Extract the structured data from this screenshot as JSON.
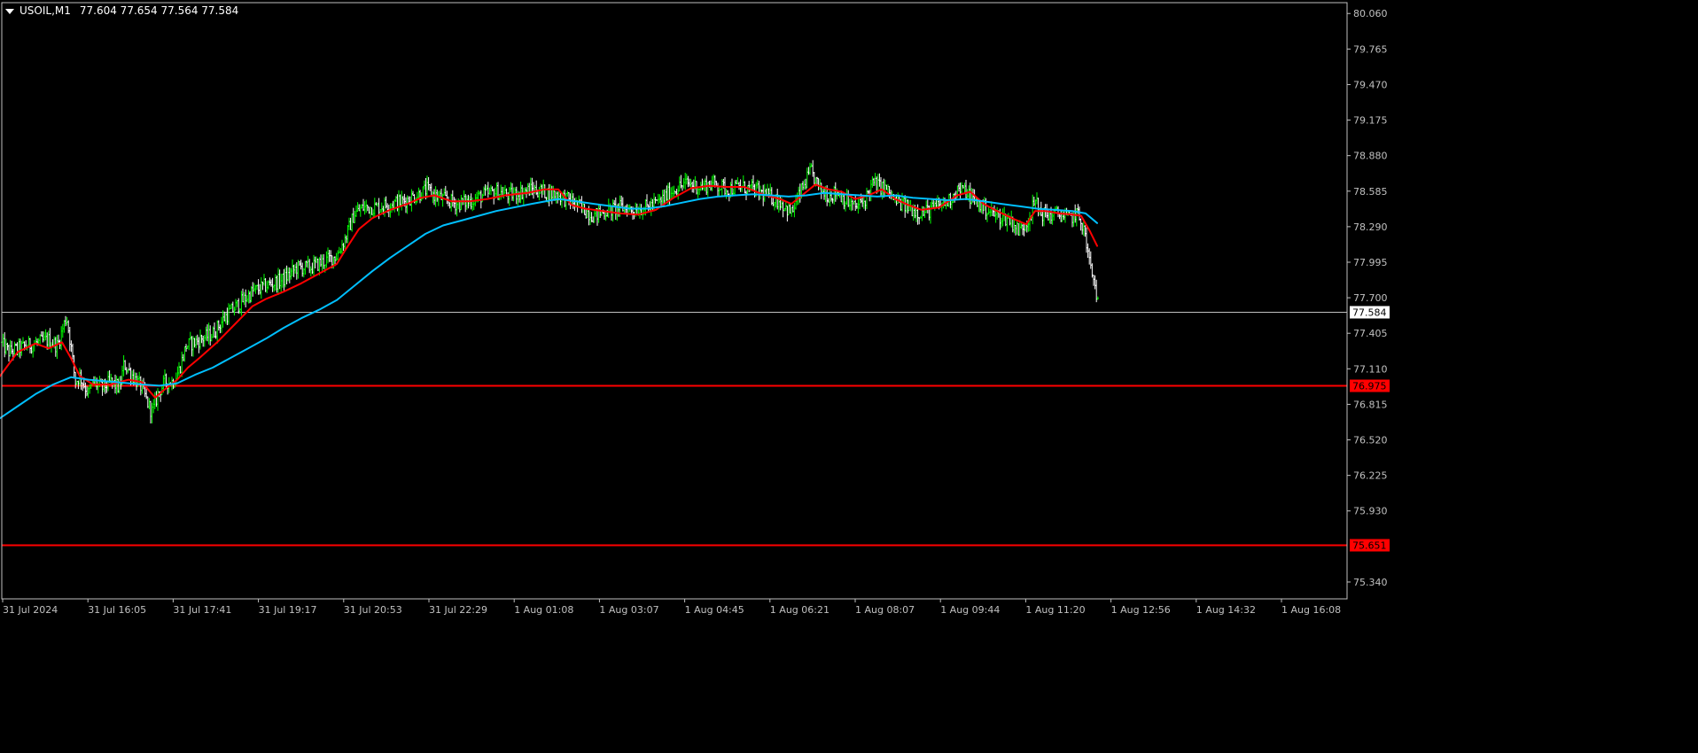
{
  "header": {
    "symbol": "USOIL,M1",
    "ohlc": "77.604 77.654 77.564 77.584",
    "menu_icon": "triangle-down-icon"
  },
  "colors": {
    "background": "#000000",
    "bull_bar": "#00ff00",
    "bear_bar": "#ffffff",
    "ma_fast": "#ff0000",
    "ma_slow": "#00bfff",
    "level_line": "#ff0000",
    "axis": "#c0c0c0",
    "bid_label_bg": "#ffffff",
    "bid_label_text": "#000000",
    "level_label_bg": "#ff0000",
    "level_label_text": "#000000"
  },
  "chart_data": {
    "type": "candlestick",
    "symbol": "USOIL",
    "timeframe": "M1",
    "ylim": [
      75.2,
      80.15
    ],
    "y_ticks": [
      "80.060",
      "79.765",
      "79.470",
      "79.175",
      "78.880",
      "78.585",
      "78.290",
      "77.995",
      "77.700",
      "77.405",
      "77.110",
      "76.815",
      "76.520",
      "76.225",
      "75.930",
      "75.340"
    ],
    "x_ticks": [
      "31 Jul 2024",
      "31 Jul 16:05",
      "31 Jul 17:41",
      "31 Jul 19:17",
      "31 Jul 20:53",
      "31 Jul 22:29",
      "1 Aug 01:08",
      "1 Aug 03:07",
      "1 Aug 04:45",
      "1 Aug 06:21",
      "1 Aug 08:07",
      "1 Aug 09:44",
      "1 Aug 11:20",
      "1 Aug 12:56",
      "1 Aug 14:32",
      "1 Aug 16:08"
    ],
    "price_path": [
      [
        0,
        77.33
      ],
      [
        10,
        77.25
      ],
      [
        30,
        77.3
      ],
      [
        55,
        77.35
      ],
      [
        65,
        77.3
      ],
      [
        75,
        77.55
      ],
      [
        80,
        77.3
      ],
      [
        85,
        77.0
      ],
      [
        90,
        77.05
      ],
      [
        100,
        76.9
      ],
      [
        105,
        77.0
      ],
      [
        115,
        76.95
      ],
      [
        125,
        77.0
      ],
      [
        135,
        76.95
      ],
      [
        140,
        77.15
      ],
      [
        150,
        77.05
      ],
      [
        160,
        76.95
      ],
      [
        168,
        76.8
      ],
      [
        172,
        76.75
      ],
      [
        178,
        76.9
      ],
      [
        186,
        77.0
      ],
      [
        195,
        77.0
      ],
      [
        202,
        77.1
      ],
      [
        210,
        77.3
      ],
      [
        225,
        77.35
      ],
      [
        240,
        77.4
      ],
      [
        255,
        77.55
      ],
      [
        270,
        77.65
      ],
      [
        285,
        77.75
      ],
      [
        300,
        77.8
      ],
      [
        320,
        77.85
      ],
      [
        335,
        77.95
      ],
      [
        350,
        77.95
      ],
      [
        365,
        78.0
      ],
      [
        380,
        78.05
      ],
      [
        390,
        78.2
      ],
      [
        400,
        78.4
      ],
      [
        410,
        78.45
      ],
      [
        425,
        78.45
      ],
      [
        440,
        78.48
      ],
      [
        455,
        78.5
      ],
      [
        470,
        78.55
      ],
      [
        482,
        78.6
      ],
      [
        490,
        78.55
      ],
      [
        500,
        78.52
      ],
      [
        515,
        78.48
      ],
      [
        530,
        78.5
      ],
      [
        545,
        78.55
      ],
      [
        560,
        78.58
      ],
      [
        575,
        78.55
      ],
      [
        590,
        78.58
      ],
      [
        600,
        78.6
      ],
      [
        615,
        78.58
      ],
      [
        630,
        78.55
      ],
      [
        645,
        78.5
      ],
      [
        655,
        78.45
      ],
      [
        670,
        78.38
      ],
      [
        685,
        78.42
      ],
      [
        700,
        78.45
      ],
      [
        715,
        78.43
      ],
      [
        730,
        78.45
      ],
      [
        745,
        78.5
      ],
      [
        760,
        78.6
      ],
      [
        775,
        78.65
      ],
      [
        790,
        78.62
      ],
      [
        805,
        78.65
      ],
      [
        820,
        78.6
      ],
      [
        835,
        78.62
      ],
      [
        850,
        78.6
      ],
      [
        865,
        78.55
      ],
      [
        880,
        78.5
      ],
      [
        893,
        78.4
      ],
      [
        905,
        78.6
      ],
      [
        915,
        78.75
      ],
      [
        925,
        78.6
      ],
      [
        935,
        78.55
      ],
      [
        945,
        78.58
      ],
      [
        955,
        78.5
      ],
      [
        965,
        78.45
      ],
      [
        975,
        78.5
      ],
      [
        985,
        78.65
      ],
      [
        1000,
        78.6
      ],
      [
        1010,
        78.5
      ],
      [
        1025,
        78.45
      ],
      [
        1040,
        78.4
      ],
      [
        1055,
        78.45
      ],
      [
        1070,
        78.5
      ],
      [
        1080,
        78.6
      ],
      [
        1090,
        78.58
      ],
      [
        1100,
        78.5
      ],
      [
        1110,
        78.45
      ],
      [
        1125,
        78.38
      ],
      [
        1140,
        78.35
      ],
      [
        1150,
        78.25
      ],
      [
        1160,
        78.35
      ],
      [
        1168,
        78.5
      ],
      [
        1175,
        78.4
      ],
      [
        1185,
        78.38
      ],
      [
        1195,
        78.4
      ],
      [
        1205,
        78.35
      ],
      [
        1215,
        78.4
      ],
      [
        1222,
        78.3
      ],
      [
        1228,
        78.05
      ],
      [
        1232,
        77.9
      ],
      [
        1237,
        77.75
      ],
      [
        1240,
        77.6
      ]
    ],
    "series": [
      {
        "name": "",
        "color": "#ff0000",
        "points": [
          [
            0,
            77.05
          ],
          [
            20,
            77.25
          ],
          [
            40,
            77.32
          ],
          [
            55,
            77.28
          ],
          [
            70,
            77.33
          ],
          [
            80,
            77.2
          ],
          [
            90,
            77.05
          ],
          [
            105,
            76.98
          ],
          [
            125,
            76.98
          ],
          [
            145,
            77.02
          ],
          [
            160,
            77.0
          ],
          [
            175,
            76.87
          ],
          [
            186,
            76.94
          ],
          [
            200,
            77.02
          ],
          [
            212,
            77.12
          ],
          [
            225,
            77.2
          ],
          [
            245,
            77.33
          ],
          [
            265,
            77.48
          ],
          [
            285,
            77.63
          ],
          [
            300,
            77.69
          ],
          [
            320,
            77.75
          ],
          [
            340,
            77.82
          ],
          [
            360,
            77.9
          ],
          [
            380,
            77.98
          ],
          [
            390,
            78.1
          ],
          [
            405,
            78.27
          ],
          [
            420,
            78.36
          ],
          [
            440,
            78.43
          ],
          [
            460,
            78.48
          ],
          [
            475,
            78.53
          ],
          [
            490,
            78.55
          ],
          [
            510,
            78.5
          ],
          [
            530,
            78.5
          ],
          [
            550,
            78.52
          ],
          [
            570,
            78.55
          ],
          [
            595,
            78.57
          ],
          [
            615,
            78.6
          ],
          [
            630,
            78.6
          ],
          [
            645,
            78.47
          ],
          [
            660,
            78.44
          ],
          [
            680,
            78.42
          ],
          [
            700,
            78.4
          ],
          [
            720,
            78.39
          ],
          [
            740,
            78.43
          ],
          [
            760,
            78.53
          ],
          [
            780,
            78.61
          ],
          [
            800,
            78.63
          ],
          [
            820,
            78.62
          ],
          [
            840,
            78.62
          ],
          [
            860,
            78.56
          ],
          [
            880,
            78.52
          ],
          [
            893,
            78.48
          ],
          [
            905,
            78.55
          ],
          [
            920,
            78.64
          ],
          [
            935,
            78.6
          ],
          [
            950,
            78.58
          ],
          [
            965,
            78.52
          ],
          [
            980,
            78.55
          ],
          [
            995,
            78.6
          ],
          [
            1010,
            78.52
          ],
          [
            1025,
            78.47
          ],
          [
            1040,
            78.43
          ],
          [
            1060,
            78.45
          ],
          [
            1080,
            78.55
          ],
          [
            1095,
            78.58
          ],
          [
            1110,
            78.48
          ],
          [
            1125,
            78.42
          ],
          [
            1145,
            78.35
          ],
          [
            1158,
            78.31
          ],
          [
            1168,
            78.42
          ],
          [
            1180,
            78.42
          ],
          [
            1195,
            78.4
          ],
          [
            1210,
            78.39
          ],
          [
            1220,
            78.38
          ],
          [
            1230,
            78.25
          ],
          [
            1238,
            78.13
          ]
        ]
      },
      {
        "name": "",
        "color": "#00bfff",
        "points": [
          [
            0,
            76.7
          ],
          [
            20,
            76.8
          ],
          [
            40,
            76.9
          ],
          [
            60,
            76.98
          ],
          [
            80,
            77.04
          ],
          [
            100,
            77.02
          ],
          [
            130,
            77.0
          ],
          [
            160,
            76.98
          ],
          [
            180,
            76.97
          ],
          [
            200,
            76.99
          ],
          [
            220,
            77.06
          ],
          [
            240,
            77.12
          ],
          [
            260,
            77.2
          ],
          [
            280,
            77.28
          ],
          [
            300,
            77.36
          ],
          [
            320,
            77.45
          ],
          [
            340,
            77.53
          ],
          [
            360,
            77.6
          ],
          [
            380,
            77.68
          ],
          [
            400,
            77.8
          ],
          [
            420,
            77.92
          ],
          [
            440,
            78.03
          ],
          [
            460,
            78.13
          ],
          [
            480,
            78.23
          ],
          [
            500,
            78.3
          ],
          [
            520,
            78.34
          ],
          [
            540,
            78.38
          ],
          [
            560,
            78.42
          ],
          [
            580,
            78.45
          ],
          [
            600,
            78.48
          ],
          [
            630,
            78.52
          ],
          [
            650,
            78.5
          ],
          [
            670,
            78.48
          ],
          [
            690,
            78.46
          ],
          [
            710,
            78.44
          ],
          [
            730,
            78.44
          ],
          [
            750,
            78.46
          ],
          [
            770,
            78.49
          ],
          [
            790,
            78.52
          ],
          [
            810,
            78.54
          ],
          [
            830,
            78.55
          ],
          [
            850,
            78.56
          ],
          [
            870,
            78.55
          ],
          [
            890,
            78.54
          ],
          [
            910,
            78.55
          ],
          [
            930,
            78.57
          ],
          [
            950,
            78.56
          ],
          [
            970,
            78.55
          ],
          [
            990,
            78.54
          ],
          [
            1010,
            78.55
          ],
          [
            1030,
            78.53
          ],
          [
            1050,
            78.52
          ],
          [
            1070,
            78.51
          ],
          [
            1090,
            78.52
          ],
          [
            1110,
            78.5
          ],
          [
            1130,
            78.48
          ],
          [
            1150,
            78.46
          ],
          [
            1170,
            78.44
          ],
          [
            1190,
            78.43
          ],
          [
            1210,
            78.42
          ],
          [
            1225,
            78.4
          ],
          [
            1238,
            78.32
          ]
        ]
      }
    ],
    "horizontal_lines": [
      {
        "price": 77.584,
        "label": "77.584",
        "style": "bid"
      },
      {
        "price": 76.975,
        "label": "76.975",
        "style": "level"
      },
      {
        "price": 75.651,
        "label": "75.651",
        "style": "level"
      }
    ]
  }
}
